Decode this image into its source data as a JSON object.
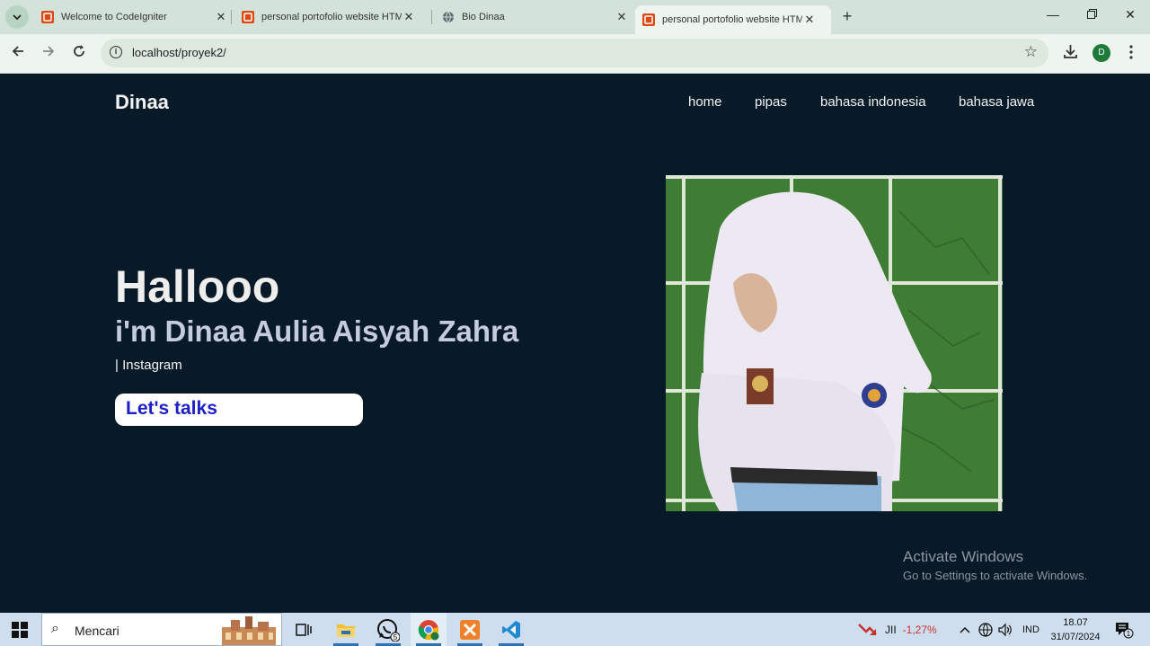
{
  "browser": {
    "tabs": [
      {
        "title": "Welcome to CodeIgniter",
        "active": false
      },
      {
        "title": "personal portofolio website HTML",
        "active": false
      },
      {
        "title": "Bio Dinaa",
        "active": false
      },
      {
        "title": "personal portofolio website HTML",
        "active": true
      }
    ],
    "url": "localhost/proyek2/",
    "profile_initial": "D"
  },
  "page": {
    "brand": "Dinaa",
    "nav": [
      "home",
      "pipas",
      "bahasa indonesia",
      "bahasa jawa"
    ],
    "hero": {
      "greeting": "Hallooo",
      "name": "i'm Dinaa Aulia Aisyah Zahra",
      "subtitle": "| Instagram",
      "cta": "Let's talks"
    }
  },
  "watermark": {
    "line1": "Activate Windows",
    "line2": "Go to Settings to activate Windows."
  },
  "taskbar": {
    "search_placeholder": "Mencari",
    "whatsapp_badge": "5",
    "stock_label": "JII",
    "stock_change": "-1,27%",
    "language": "IND",
    "time": "18.07",
    "date": "31/07/2024",
    "notification_count": "1"
  }
}
